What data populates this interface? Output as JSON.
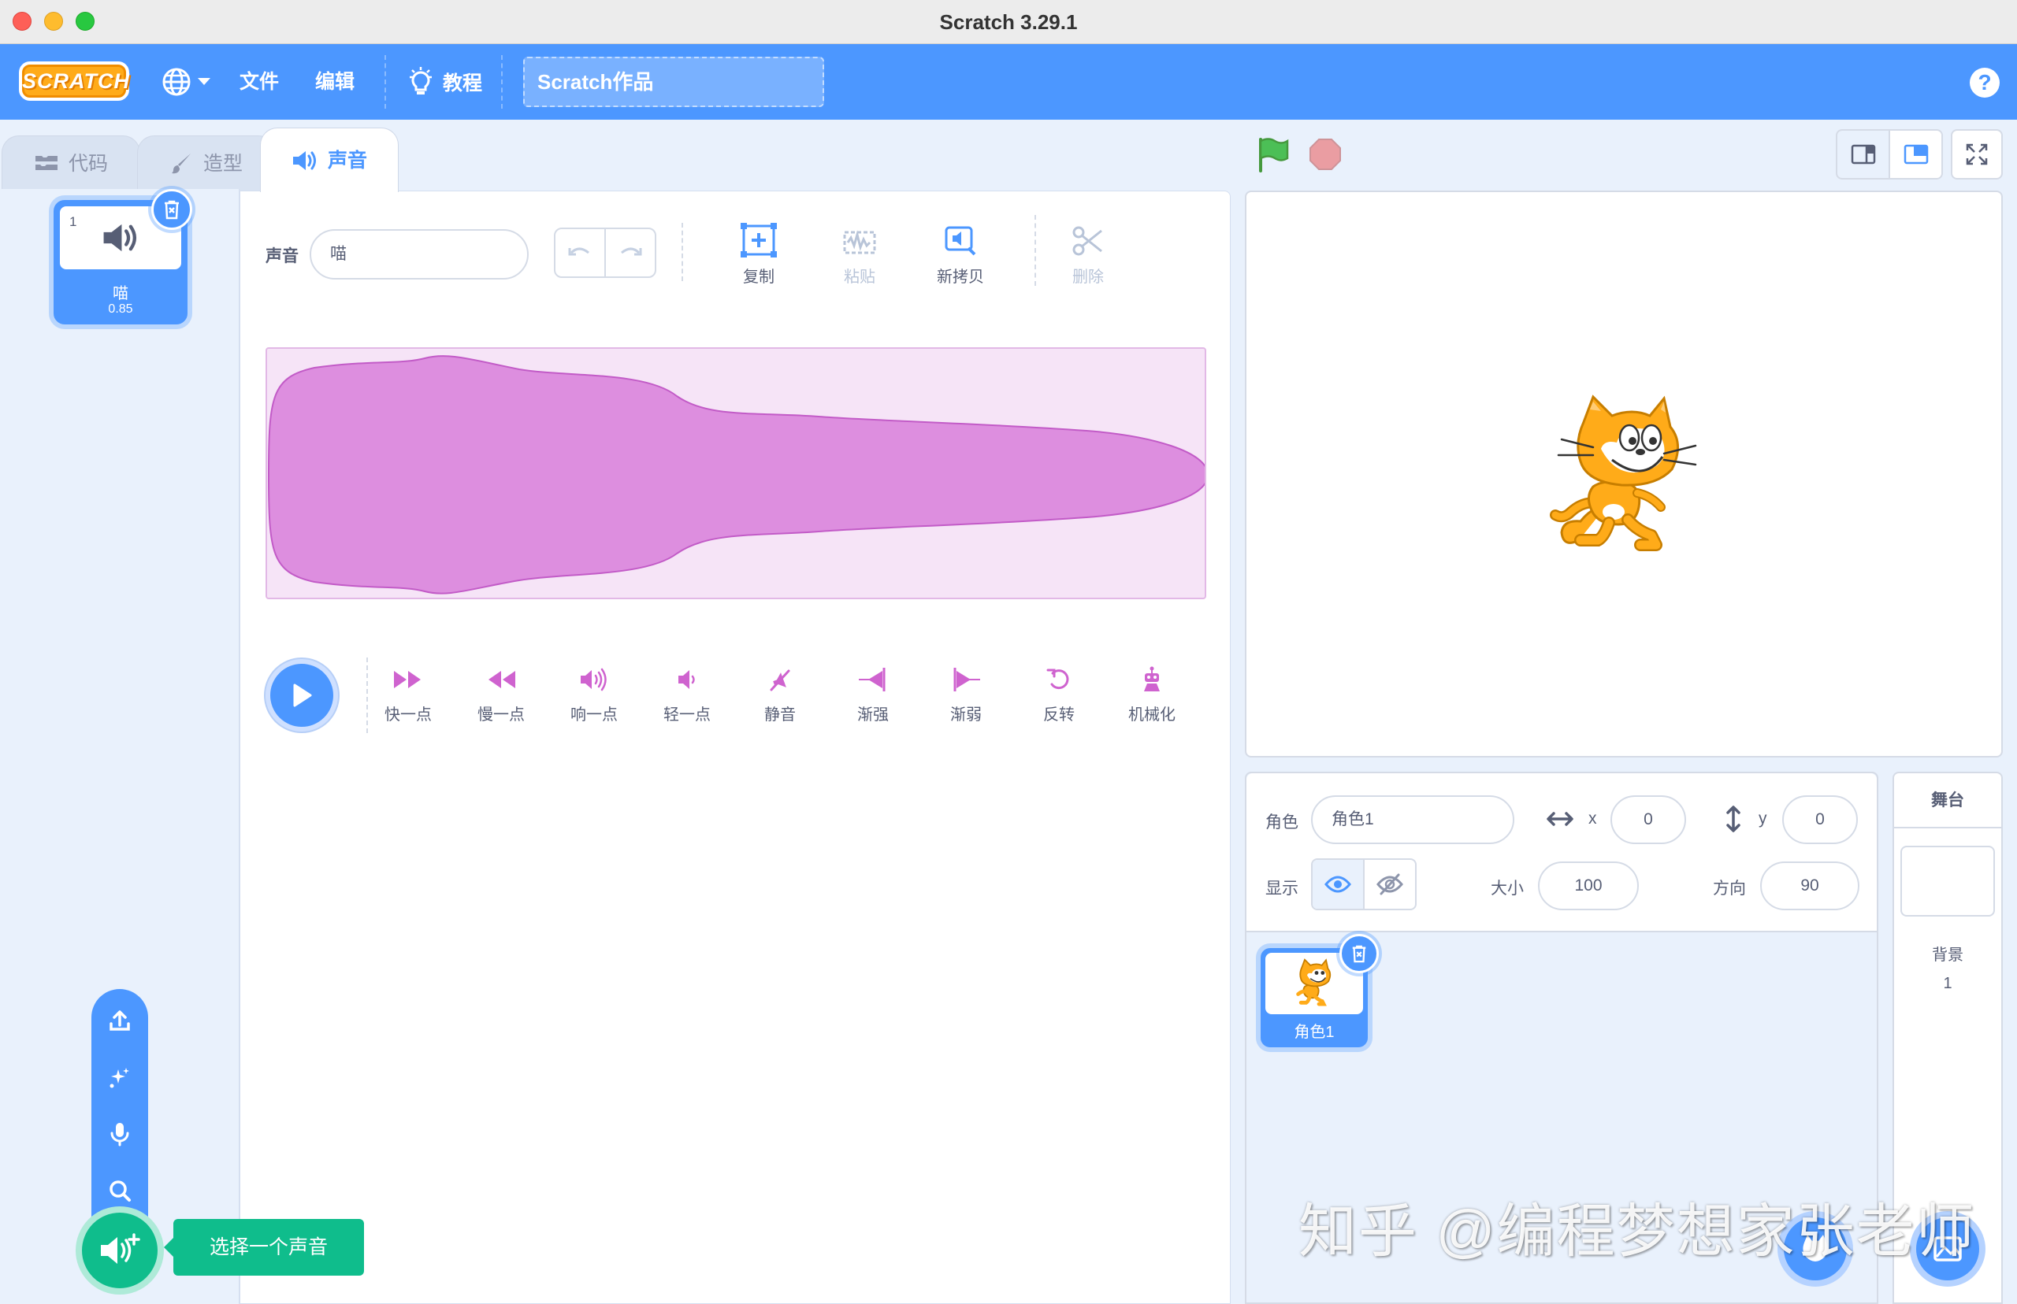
{
  "window": {
    "title": "Scratch 3.29.1"
  },
  "menubar": {
    "logo": "SCRATCH",
    "file": "文件",
    "edit": "编辑",
    "tutorials": "教程",
    "project_title": "Scratch作品",
    "help": "?"
  },
  "tabs": {
    "code": "代码",
    "costumes": "造型",
    "sounds": "声音"
  },
  "sound_list": {
    "items": [
      {
        "index": "1",
        "name": "喵",
        "duration": "0.85"
      }
    ]
  },
  "editor": {
    "sound_label": "声音",
    "sound_name": "喵",
    "tools": {
      "copy": "复制",
      "paste": "粘贴",
      "copy_to_new": "新拷贝",
      "delete": "删除"
    },
    "effects": {
      "faster": "快一点",
      "slower": "慢一点",
      "louder": "响一点",
      "softer": "轻一点",
      "mute": "静音",
      "fade_in": "渐强",
      "fade_out": "渐弱",
      "reverse": "反转",
      "robot": "机械化"
    }
  },
  "add_sound": {
    "tooltip": "选择一个声音"
  },
  "sprite_info": {
    "sprite_label": "角色",
    "sprite_name": "角色1",
    "x_label": "x",
    "x": "0",
    "y_label": "y",
    "y": "0",
    "show_label": "显示",
    "size_label": "大小",
    "size": "100",
    "direction_label": "方向",
    "direction": "90"
  },
  "sprites": [
    {
      "name": "角色1"
    }
  ],
  "stage_pane": {
    "title": "舞台",
    "backdrops_label": "背景",
    "backdrop_count": "1"
  },
  "watermark": "知乎 @编程梦想家张老师",
  "colors": {
    "primary": "#4c97ff",
    "sound_purple": "#cf63cf",
    "extension_green": "#0fbd8c",
    "waveform_bg": "#f6e4f7"
  }
}
